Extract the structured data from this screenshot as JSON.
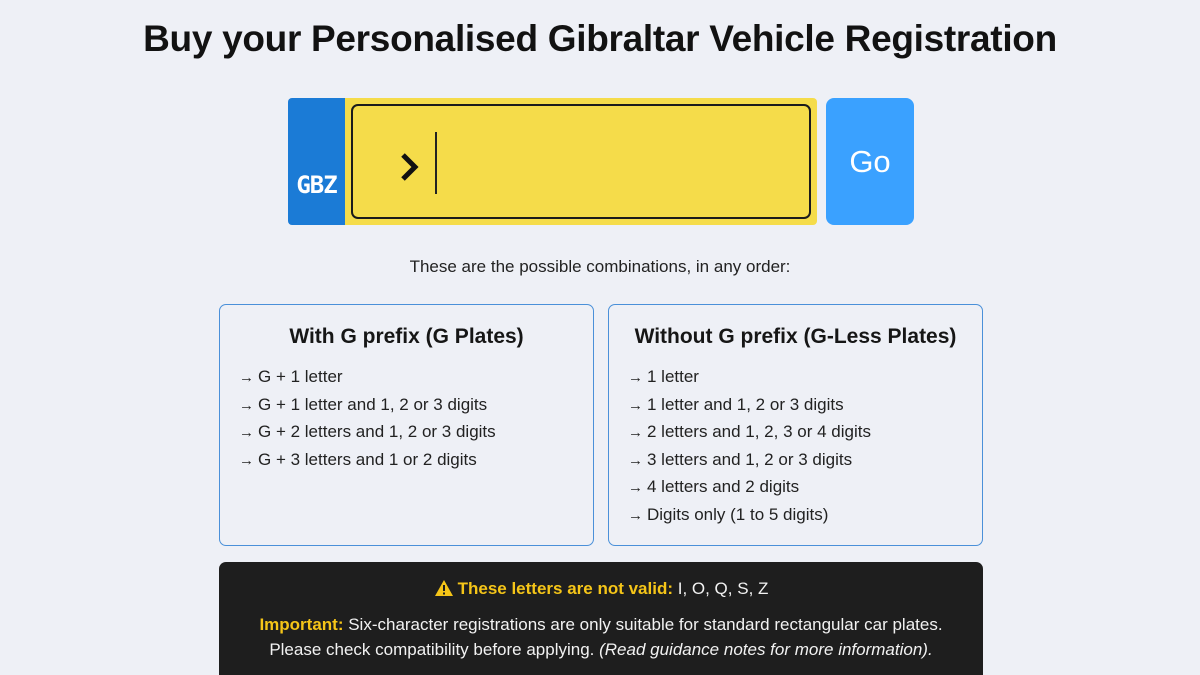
{
  "page": {
    "title": "Buy your Personalised Gibraltar Vehicle Registration"
  },
  "plate": {
    "country_code": "GBZ",
    "input_value": "",
    "go_label": "Go",
    "colors": {
      "country_band": "#1b7bd6",
      "plate": "#f5dc4a",
      "go_button": "#3aa1ff"
    }
  },
  "combinations": {
    "intro": "These are the possible combinations, in any order:",
    "with_g": {
      "title": "With G prefix (G Plates)",
      "items": [
        "G + 1 letter",
        "G + 1 letter and 1, 2 or 3 digits",
        "G + 2 letters and 1, 2 or 3 digits",
        "G + 3 letters and 1 or 2 digits"
      ]
    },
    "without_g": {
      "title": "Without G prefix (G-Less Plates)",
      "items": [
        "1 letter",
        "1 letter and 1, 2 or 3 digits",
        "2 letters and 1, 2, 3 or 4 digits",
        "3 letters and 1, 2 or 3 digits",
        "4 letters and 2 digits",
        "Digits only (1 to 5 digits)"
      ]
    }
  },
  "notice": {
    "warning_label": "These letters are not valid:",
    "invalid_letters": " I, O, Q, S, Z",
    "important_label": "Important:",
    "important_text": " Six-character registrations are only suitable for standard rectangular car plates. Please check compatibility before applying. ",
    "guidance_text": "(Read guidance notes for more information).",
    "accent_color": "#f5c518"
  }
}
